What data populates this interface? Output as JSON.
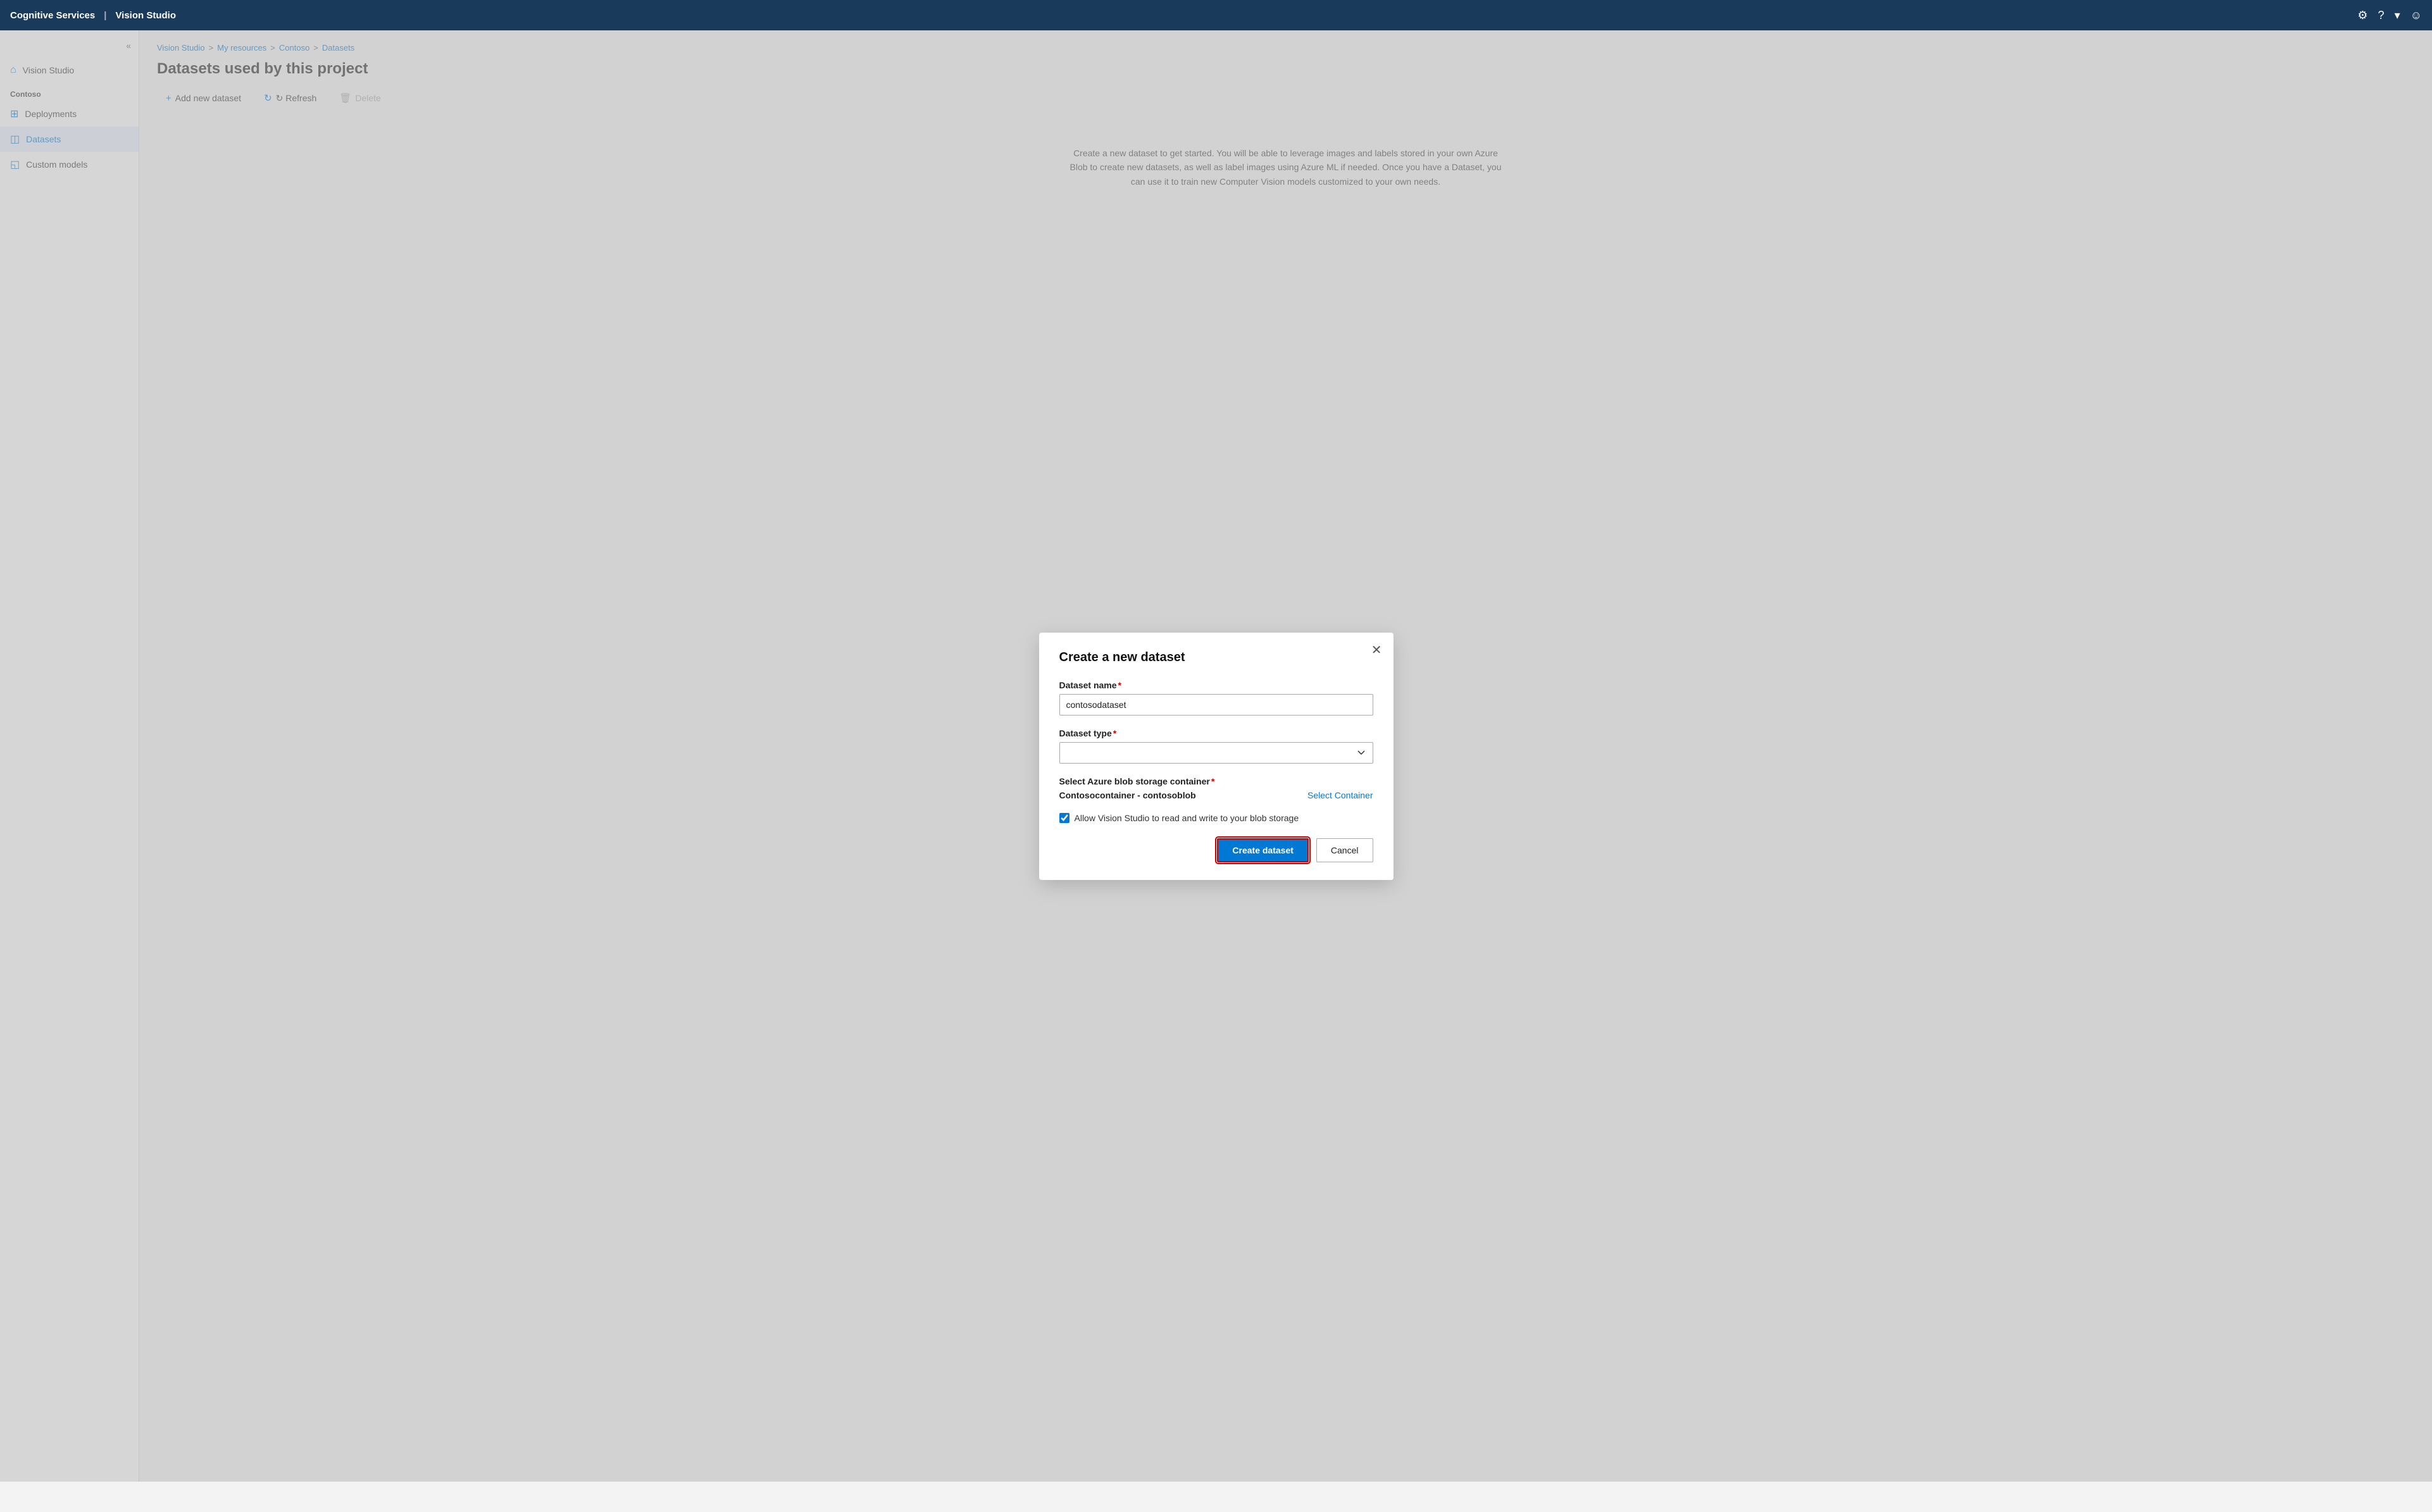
{
  "topNav": {
    "brand": "Cognitive Services",
    "separator": "|",
    "appName": "Vision Studio",
    "icons": {
      "settings": "⚙",
      "help": "?",
      "dropdown": "▾",
      "user": "☺"
    }
  },
  "sidebar": {
    "collapse_icon": "«",
    "home_item": "Vision Studio",
    "section_label": "Contoso",
    "items": [
      {
        "id": "deployments",
        "label": "Deployments",
        "icon": "⊞"
      },
      {
        "id": "datasets",
        "label": "Datasets",
        "icon": "◫",
        "active": true
      },
      {
        "id": "custom-models",
        "label": "Custom models",
        "icon": "◱"
      }
    ]
  },
  "breadcrumb": {
    "items": [
      {
        "label": "Vision Studio",
        "link": true
      },
      {
        "label": "My resources",
        "link": true
      },
      {
        "label": "Contoso",
        "link": true
      },
      {
        "label": "Datasets",
        "link": true
      }
    ],
    "separator": ">"
  },
  "page": {
    "title": "Datasets used by this project",
    "toolbar": {
      "add_label": "+ Add new dataset",
      "refresh_label": "↻ Refresh",
      "delete_label": "🗑 Delete"
    }
  },
  "modal": {
    "title": "Create a new dataset",
    "close_icon": "✕",
    "fields": {
      "dataset_name": {
        "label": "Dataset name",
        "required": true,
        "value": "contosodataset",
        "placeholder": ""
      },
      "dataset_type": {
        "label": "Dataset type",
        "required": true,
        "value": "",
        "placeholder": "",
        "options": []
      },
      "storage": {
        "label": "Select Azure blob storage container",
        "required": true,
        "container_name": "Contosocontainer - contosoblob",
        "select_link": "Select Container"
      },
      "allow_access": {
        "label": "Allow Vision Studio to read and write to your blob storage",
        "checked": true
      }
    },
    "buttons": {
      "create": "Create dataset",
      "cancel": "Cancel"
    }
  },
  "bg_description": "Create a new dataset to get started. You will be able to leverage images and labels stored in your own Azure Blob to create new datasets, as well as label images using Azure ML if needed. Once you have a Dataset, you can use it to train new Computer Vision models customized to your own needs."
}
